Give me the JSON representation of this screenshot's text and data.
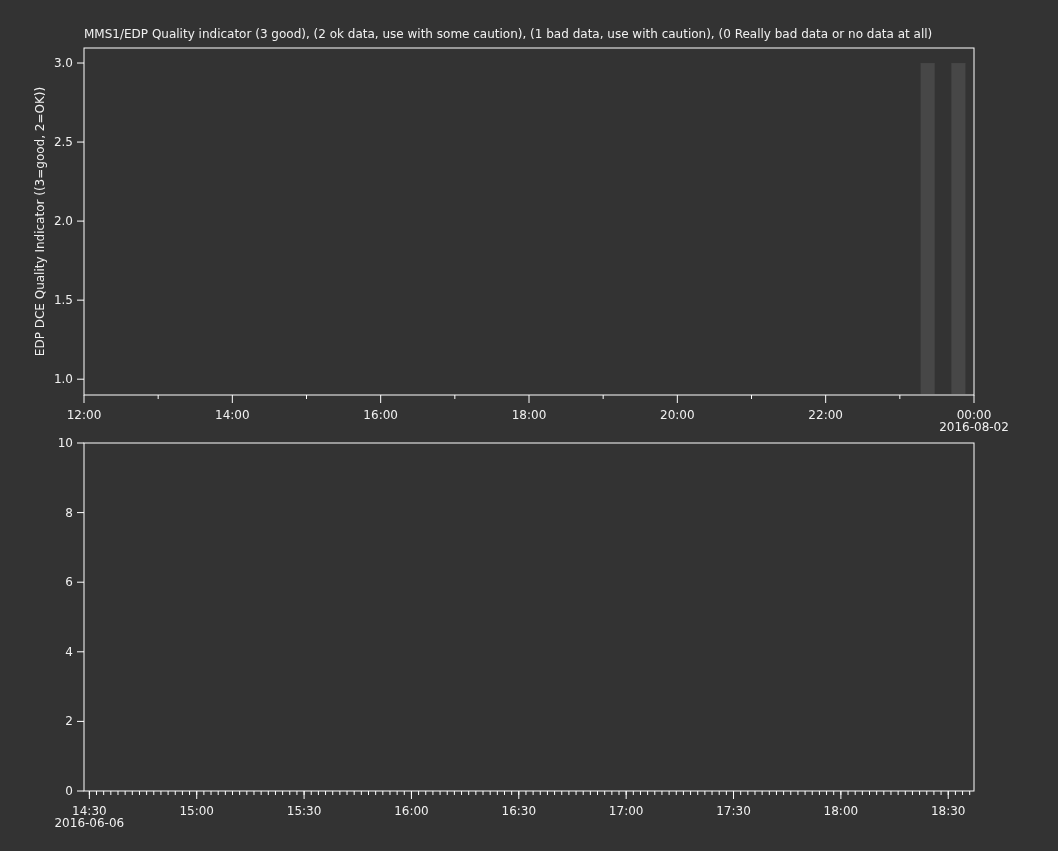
{
  "panels": [
    {
      "chart_data": {
        "type": "bar",
        "title": "MMS1/EDP  Quality indicator (3 good), (2 ok data, use with some caution), (1 bad data, use with caution), (0 Really bad data or no data at all)",
        "ylabel": "EDP DCE Quality Indicator ((3=good, 2=OK))",
        "xlim": [
          12,
          24
        ],
        "ylim": [
          0.9,
          3.095
        ],
        "x": [
          23.375,
          23.79
        ],
        "values": [
          3,
          3
        ],
        "yticks": [
          {
            "value": 1,
            "label": "1.0"
          },
          {
            "value": 1.5,
            "label": "1.5"
          },
          {
            "value": 2,
            "label": "2.0"
          },
          {
            "value": 2.5,
            "label": "2.5"
          },
          {
            "value": 3,
            "label": "3.0"
          }
        ],
        "xticks": [
          {
            "value": 12,
            "label": "12:00"
          },
          {
            "value": 14,
            "label": "14:00"
          },
          {
            "value": 16,
            "label": "16:00"
          },
          {
            "value": 18,
            "label": "18:00"
          },
          {
            "value": 20,
            "label": "20:00"
          },
          {
            "value": 22,
            "label": "22:00"
          },
          {
            "value": 24,
            "label": "00:00\n2016-08-02"
          }
        ]
      }
    },
    {
      "chart_data": {
        "type": "line",
        "xlim": [
          14.475,
          18.62
        ],
        "ylim": [
          0,
          10
        ],
        "yticks": [
          0,
          2,
          4,
          6,
          8,
          10
        ],
        "xticks": [
          {
            "value": 14.5,
            "label": "14:30\n2016-06-06"
          },
          {
            "value": 15,
            "label": "15:00"
          },
          {
            "value": 15.5,
            "label": "15:30"
          },
          {
            "value": 16,
            "label": "16:00"
          },
          {
            "value": 16.5,
            "label": "16:30"
          },
          {
            "value": 17,
            "label": "17:00"
          },
          {
            "value": 17.5,
            "label": "17:30"
          },
          {
            "value": 18,
            "label": "18:00"
          },
          {
            "value": 18.5,
            "label": "18:30"
          }
        ]
      }
    }
  ]
}
